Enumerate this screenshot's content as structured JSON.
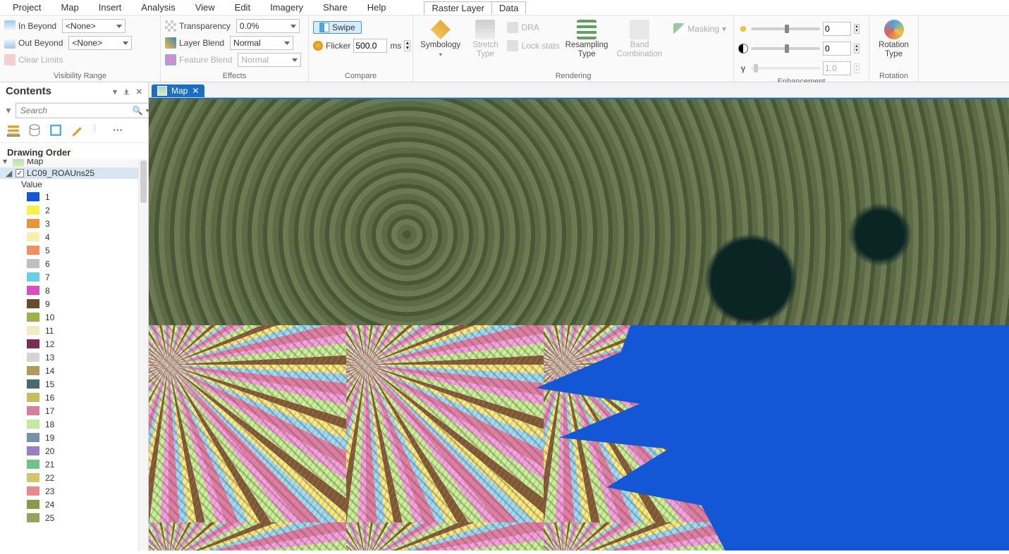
{
  "menu": {
    "items": [
      "Project",
      "Map",
      "Insert",
      "Analysis",
      "View",
      "Edit",
      "Imagery",
      "Share",
      "Help"
    ],
    "context_tabs": [
      "Raster Layer",
      "Data"
    ],
    "active_context": "Raster Layer"
  },
  "ribbon": {
    "visibility": {
      "in_beyond": "In Beyond",
      "out_beyond": "Out Beyond",
      "clear_limits": "Clear Limits",
      "none_value": "<None>",
      "group_label": "Visibility Range"
    },
    "effects": {
      "transparency_label": "Transparency",
      "transparency_value": "0.0%",
      "layer_blend_label": "Layer Blend",
      "layer_blend_value": "Normal",
      "feature_blend_label": "Feature Blend",
      "feature_blend_value": "Normal",
      "group_label": "Effects"
    },
    "compare": {
      "swipe": "Swipe",
      "flicker": "Flicker",
      "flicker_value": "500.0",
      "flicker_unit": "ms",
      "group_label": "Compare"
    },
    "rendering": {
      "symbology": "Symbology",
      "stretch_type": "Stretch\nType",
      "dra": "DRA",
      "lock_stats": "Lock stats",
      "resampling_type": "Resampling\nType",
      "band_combination": "Band\nCombination",
      "masking": "Masking",
      "group_label": "Rendering"
    },
    "enhancement": {
      "value_a": "0",
      "value_b": "0",
      "value_c": "1.0",
      "group_label": "Enhancement"
    },
    "rotation": {
      "label": "Rotation\nType",
      "group_label": "Rotation"
    }
  },
  "contents": {
    "title": "Contents",
    "search_placeholder": "Search",
    "drawing_order": "Drawing Order",
    "root_item": "Map",
    "layer_name": "LC09_ROAUns25",
    "value_header": "Value",
    "legend": [
      {
        "v": "1",
        "c": "#1356d6"
      },
      {
        "v": "2",
        "c": "#f2f24a"
      },
      {
        "v": "3",
        "c": "#e6953a"
      },
      {
        "v": "4",
        "c": "#f5f0b0"
      },
      {
        "v": "5",
        "c": "#f09060"
      },
      {
        "v": "6",
        "c": "#bfbfbf"
      },
      {
        "v": "7",
        "c": "#66d0e6"
      },
      {
        "v": "8",
        "c": "#d94fc0"
      },
      {
        "v": "9",
        "c": "#6b4a2e"
      },
      {
        "v": "10",
        "c": "#a0b04a"
      },
      {
        "v": "11",
        "c": "#f2eac0"
      },
      {
        "v": "12",
        "c": "#7b2d52"
      },
      {
        "v": "13",
        "c": "#d4d4d4"
      },
      {
        "v": "14",
        "c": "#b09a5e"
      },
      {
        "v": "15",
        "c": "#4a6a72"
      },
      {
        "v": "16",
        "c": "#c0c060"
      },
      {
        "v": "17",
        "c": "#d47f9e"
      },
      {
        "v": "18",
        "c": "#c4e8a0"
      },
      {
        "v": "19",
        "c": "#7690a8"
      },
      {
        "v": "20",
        "c": "#9a7fc4"
      },
      {
        "v": "21",
        "c": "#6ec48a"
      },
      {
        "v": "22",
        "c": "#d4c46e"
      },
      {
        "v": "23",
        "c": "#e68a8a"
      },
      {
        "v": "24",
        "c": "#8a9a4a"
      },
      {
        "v": "25",
        "c": "#9aa060"
      }
    ]
  },
  "view": {
    "tab_name": "Map"
  }
}
